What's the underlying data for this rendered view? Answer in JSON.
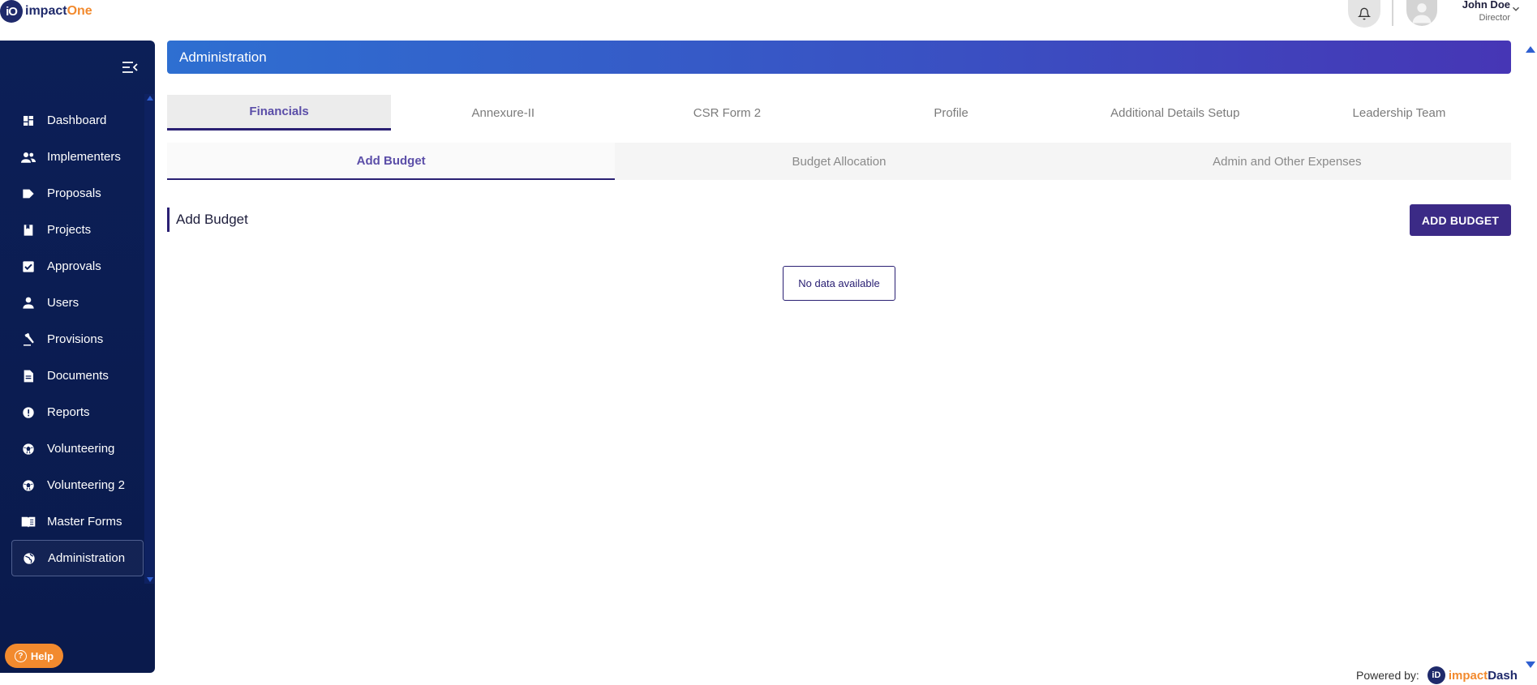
{
  "app": {
    "logo_badge": "iO",
    "logo_prefix": "impact",
    "logo_suffix": "One"
  },
  "user": {
    "name": "John Doe",
    "role": "Director"
  },
  "sidebar": {
    "items": [
      {
        "label": "Dashboard",
        "icon": "dashboard-icon"
      },
      {
        "label": "Implementers",
        "icon": "people-icon"
      },
      {
        "label": "Proposals",
        "icon": "tag-icon"
      },
      {
        "label": "Projects",
        "icon": "book-icon"
      },
      {
        "label": "Approvals",
        "icon": "checkbox-icon"
      },
      {
        "label": "Users",
        "icon": "person-icon"
      },
      {
        "label": "Provisions",
        "icon": "gavel-icon"
      },
      {
        "label": "Documents",
        "icon": "document-icon"
      },
      {
        "label": "Reports",
        "icon": "alert-circle-icon"
      },
      {
        "label": "Volunteering",
        "icon": "soccer-ball-icon"
      },
      {
        "label": "Volunteering 2",
        "icon": "soccer-ball-icon"
      },
      {
        "label": "Master Forms",
        "icon": "open-book-icon"
      },
      {
        "label": "Administration",
        "icon": "globe-icon",
        "active": true
      }
    ],
    "help_label": "Help",
    "help_icon": "?"
  },
  "header": {
    "title": "Administration"
  },
  "tabs": [
    {
      "label": "Financials",
      "active": true
    },
    {
      "label": "Annexure-II"
    },
    {
      "label": "CSR Form 2"
    },
    {
      "label": "Profile"
    },
    {
      "label": "Additional Details Setup"
    },
    {
      "label": "Leadership Team"
    }
  ],
  "subtabs": [
    {
      "label": "Add Budget",
      "active": true
    },
    {
      "label": "Budget Allocation"
    },
    {
      "label": "Admin and Other Expenses"
    }
  ],
  "section": {
    "title": "Add Budget",
    "action_label": "ADD BUDGET",
    "empty_message": "No data available"
  },
  "footer": {
    "powered_label": "Powered by:",
    "brand_badge": "iD",
    "brand_prefix": "impact",
    "brand_suffix": "Dash"
  },
  "colors": {
    "sidebar_bg": "#0c1f57",
    "accent": "#3b2a86",
    "brand_orange": "#f28a2e",
    "header_gradient_start": "#2e6fd1",
    "header_gradient_end": "#4636b5"
  }
}
